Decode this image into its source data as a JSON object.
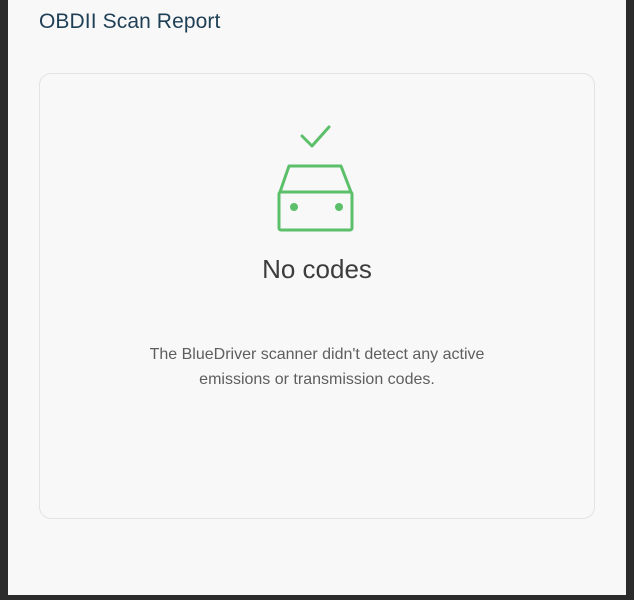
{
  "header": {
    "title": "OBDII Scan Report"
  },
  "result": {
    "icons": [
      "checkmark-icon",
      "car-front-icon"
    ],
    "accent_color": "#5cbf6a",
    "title": "No codes",
    "description": "The BlueDriver scanner didn't detect any active emissions or transmission codes."
  }
}
